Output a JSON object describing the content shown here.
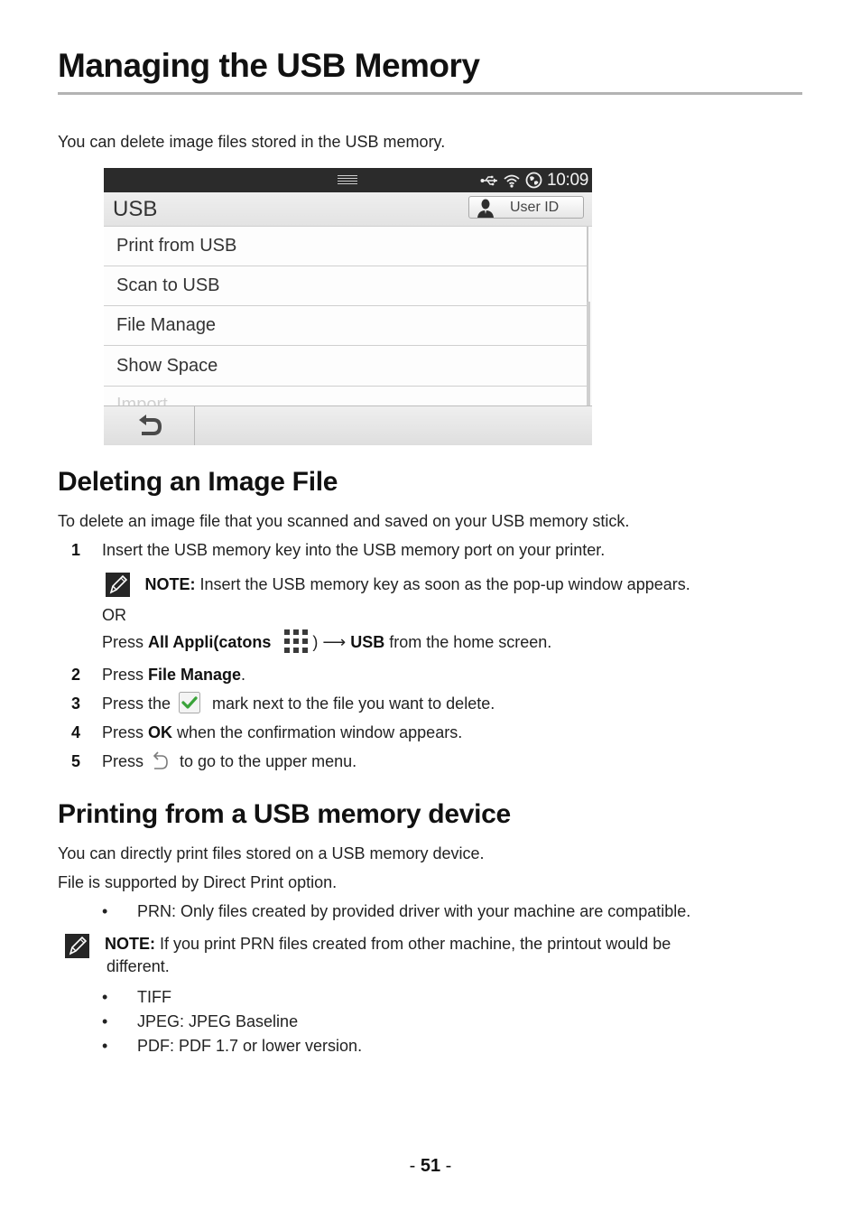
{
  "page": {
    "title": "Managing the USB Memory",
    "intro": "You can delete image files stored in the USB memory.",
    "page_number": "51",
    "page_number_prefix": "- ",
    "page_number_suffix": " -"
  },
  "device_screen": {
    "status_bar": {
      "icons": [
        "usb-icon",
        "wifi-icon",
        "network-globe-icon"
      ],
      "time": "10:09"
    },
    "title": "USB",
    "user_id_button": "User ID",
    "menu_items": [
      {
        "label": "Print from USB"
      },
      {
        "label": "Scan to USB"
      },
      {
        "label": "File Manage"
      },
      {
        "label": "Show Space"
      },
      {
        "label": "Import"
      }
    ],
    "back_button_icon": "back-arrow-icon"
  },
  "section_delete": {
    "heading": "Deleting an Image File",
    "intro": "To delete an image file that you scanned and saved on your USB memory stick.",
    "steps": [
      {
        "num": "1",
        "text": "Insert the USB memory key into the USB memory port on your printer."
      },
      {
        "num": "2",
        "pre": "Press ",
        "bold": "File Manage",
        "post": "."
      },
      {
        "num": "3",
        "pre": "Press the ",
        "icon": "checkmark-icon",
        "post": " mark next to the file you want to delete."
      },
      {
        "num": "4",
        "pre": "Press ",
        "bold": "OK",
        "post": " when the confirmation window appears."
      },
      {
        "num": "5",
        "pre": "Press ",
        "icon": "back-arrow-icon",
        "post": " to go to the upper menu."
      }
    ],
    "note": {
      "label": "NOTE:",
      "text": " Insert the USB memory key as soon as the pop-up window appears."
    },
    "or_text": "OR",
    "alt_step": {
      "pre": "Press ",
      "bold1": "All Appli(catons",
      "mid": " ) ",
      "arrow": "⟶",
      "bold2": "USB",
      "post": " from the home screen."
    }
  },
  "section_print": {
    "heading": "Printing from a USB memory device",
    "line1": "You can directly print files stored on a USB memory device.",
    "line2": "File is supported by Direct Print option.",
    "bullet_prn": "PRN: Only files created by provided driver with your machine are compatible.",
    "note": {
      "label": "NOTE:",
      "text_line1": " If you print PRN files created from other machine, the printout would be",
      "text_line2": "different."
    },
    "bullets": [
      "TIFF",
      "JPEG: JPEG Baseline",
      "PDF: PDF 1.7 or lower version."
    ]
  }
}
